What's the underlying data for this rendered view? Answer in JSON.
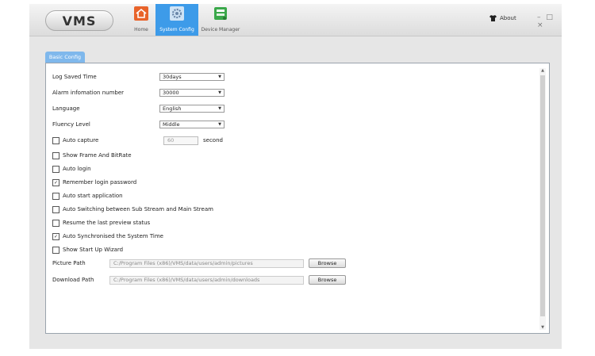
{
  "app": {
    "logo": "VMS"
  },
  "tabs": [
    {
      "label": "Home"
    },
    {
      "label": "System Config"
    },
    {
      "label": "Device Manager"
    }
  ],
  "header": {
    "about": "About",
    "window_controls": "– □ ×"
  },
  "panel": {
    "tab_label": "Basic Config"
  },
  "settings": {
    "log_saved_time": {
      "label": "Log Saved Time",
      "value": "30days"
    },
    "alarm_number": {
      "label": "Alarm infomation number",
      "value": "30000"
    },
    "language": {
      "label": "Language",
      "value": "English"
    },
    "fluency": {
      "label": "Fluency Level",
      "value": "Middle"
    },
    "auto_capture": {
      "label": "Auto capture",
      "checked": false,
      "value": "60",
      "unit": "second"
    }
  },
  "checkboxes": [
    {
      "label": "Show Frame And BitRate",
      "checked": false
    },
    {
      "label": "Auto login",
      "checked": false
    },
    {
      "label": "Remember login password",
      "checked": true
    },
    {
      "label": "Auto start application",
      "checked": false
    },
    {
      "label": "Auto Switching between Sub Stream and Main Stream",
      "checked": false
    },
    {
      "label": "Resume the last preview status",
      "checked": false
    },
    {
      "label": "Auto Synchronised the System Time",
      "checked": true
    },
    {
      "label": "Show Start Up Wizard",
      "checked": false
    }
  ],
  "paths": {
    "picture": {
      "label": "Picture Path",
      "value": "C:/Program Files (x86)/VMS/data/users/admin/pictures",
      "button": "Browse"
    },
    "download": {
      "label": "Download Path",
      "value": "C:/Program Files (x86)/VMS/data/users/admin/downloads",
      "button": "Browse"
    }
  },
  "colors": {
    "active_tab": "#3d9be9",
    "panel_tab": "#7fb8ec"
  },
  "icons": {
    "home": "home-icon",
    "config": "gear-icon",
    "device": "device-manager-icon",
    "about": "shirt-icon"
  }
}
